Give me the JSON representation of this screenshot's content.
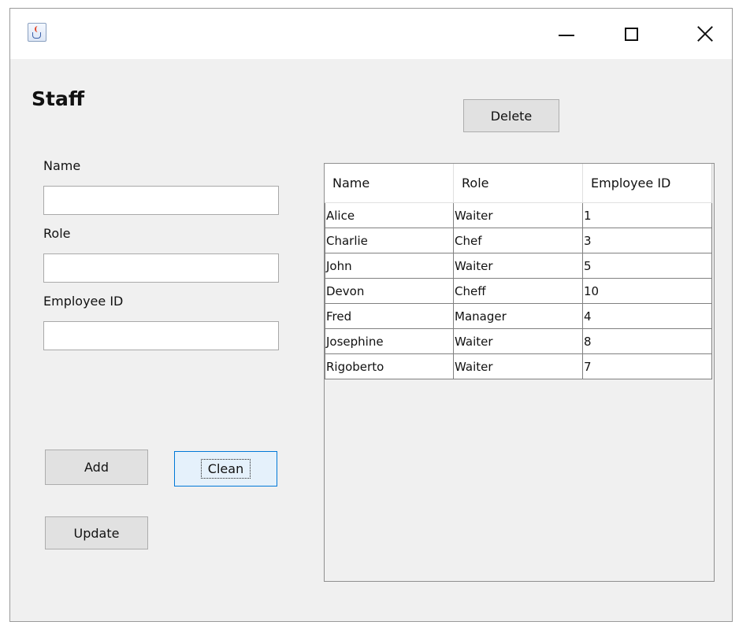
{
  "window": {
    "icon": "java-coffee-cup-icon",
    "controls": {
      "minimize": "minimize-icon",
      "maximize": "maximize-icon",
      "close": "close-icon"
    }
  },
  "form": {
    "title": "Staff",
    "name_label": "Name",
    "name_value": "",
    "role_label": "Role",
    "role_value": "",
    "employee_id_label": "Employee ID",
    "employee_id_value": ""
  },
  "buttons": {
    "delete": "Delete",
    "add": "Add",
    "clean": "Clean",
    "update": "Update"
  },
  "table": {
    "columns": [
      "Name",
      "Role",
      "Employee ID"
    ],
    "rows": [
      [
        "Alice",
        "Waiter",
        "1"
      ],
      [
        "Charlie",
        "Chef",
        "3"
      ],
      [
        "John",
        "Waiter",
        "5"
      ],
      [
        "Devon",
        "Cheff",
        "10"
      ],
      [
        "Fred",
        "Manager",
        "4"
      ],
      [
        "Josephine",
        "Waiter",
        "8"
      ],
      [
        "Rigoberto",
        "Waiter",
        "7"
      ]
    ]
  }
}
